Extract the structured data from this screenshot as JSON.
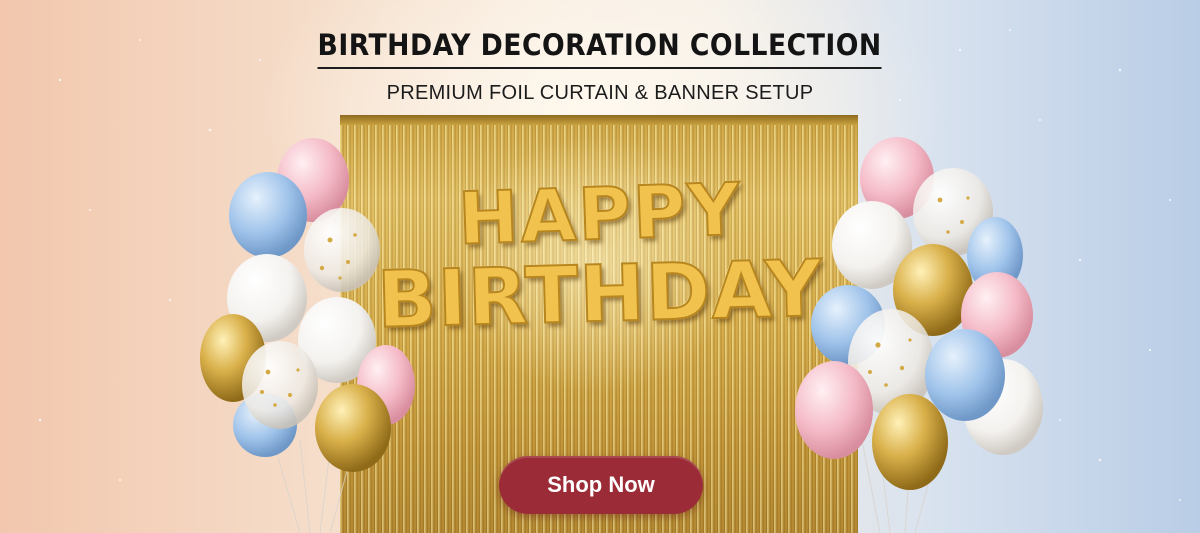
{
  "banner": {
    "title": "BIRTHDAY DECORATION COLLECTION",
    "subtitle": "PREMIUM FOIL CURTAIN & BANNER SETUP",
    "balloon_line_1": "HAPPY",
    "balloon_line_2": "BIRTHDAY",
    "cta_label": "Shop Now"
  },
  "colors": {
    "title_text": "#141414",
    "cta_background": "#9b2b36",
    "cta_text": "#ffffff",
    "foil_gold": "#d5ad4a",
    "balloon_pink": "#f4b9c6",
    "balloon_blue": "#9fc3ea",
    "balloon_white": "#f7f6f4",
    "balloon_gold": "#d1a63d"
  },
  "icons": {
    "left_cluster": "balloon-bouquet",
    "right_cluster": "balloon-bouquet"
  }
}
